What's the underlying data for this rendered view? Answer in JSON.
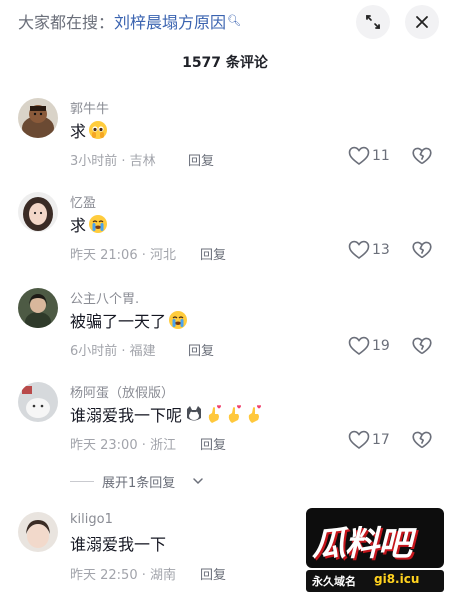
{
  "search": {
    "prefix": "大家都在搜：",
    "term": "刘梓晨塌方原因",
    "icon": "search-icon"
  },
  "header": {
    "expand_icon": "expand-icon",
    "close_icon": "close-icon"
  },
  "comment_count": "1577 条评论",
  "comments": [
    {
      "name": "郭牛牛",
      "text": "求",
      "emoji": "pleading-face",
      "time": "3小时前 · 吉林",
      "reply": "回复",
      "likes": "11"
    },
    {
      "name": "忆盈",
      "text": "求",
      "emoji": "crying-face",
      "time": "昨天 21:06 · 河北",
      "reply": "回复",
      "likes": "13"
    },
    {
      "name": "公主八个胃.",
      "text": "被骗了一天了",
      "emoji": "crying-face",
      "time": "6小时前 · 福建",
      "reply": "回复",
      "likes": "19"
    },
    {
      "name": "杨阿蛋（放假版）",
      "text": "谁溺爱我一下呢",
      "emoji": "cat-face, three crossed-fingers-heart",
      "time": "昨天 23:00 · 浙江",
      "reply": "回复",
      "likes": "17"
    },
    {
      "name": "kiligo1",
      "text": "谁溺爱我一下",
      "emoji": "",
      "time": "昨天 22:50 · 湖南",
      "reply": "回复",
      "likes": ""
    }
  ],
  "expand_replies": "展开1条回复",
  "watermark": {
    "logo": "瓜料吧",
    "label": "永久域名",
    "domain": "gi8.icu"
  },
  "colors": {
    "link": "#3a63b0",
    "muted": "#a2a4ab",
    "text": "#161823"
  }
}
